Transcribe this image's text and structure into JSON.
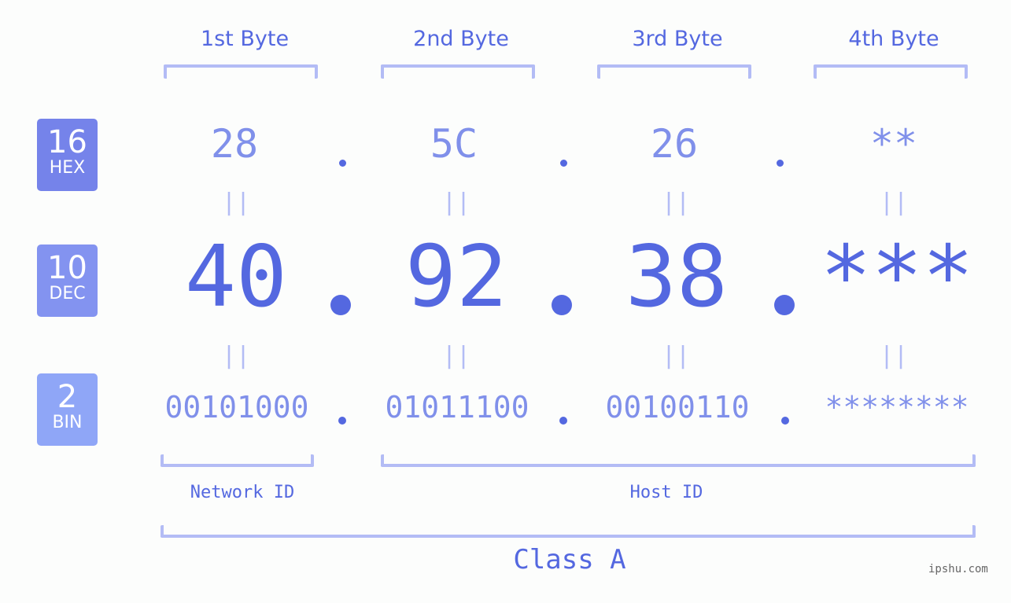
{
  "byte_headers": [
    "1st Byte",
    "2nd Byte",
    "3rd Byte",
    "4th Byte"
  ],
  "badges": [
    {
      "number": "16",
      "label": "HEX",
      "color": "#7583ea"
    },
    {
      "number": "10",
      "label": "DEC",
      "color": "#8393f0"
    },
    {
      "number": "2",
      "label": "BIN",
      "color": "#8fa6f7"
    }
  ],
  "hex": [
    "28",
    "5C",
    "26",
    "**"
  ],
  "dec": [
    "40",
    "92",
    "38",
    "***"
  ],
  "bin": [
    "00101000",
    "01011100",
    "00100110",
    "********"
  ],
  "equals": "=",
  "network_label": "Network ID",
  "host_label": "Host ID",
  "class_label": "Class A",
  "watermark": "ipshu.com",
  "colors": {
    "primary": "#5468e0",
    "light": "#8090ea",
    "bracket": "#b3bcf5"
  }
}
